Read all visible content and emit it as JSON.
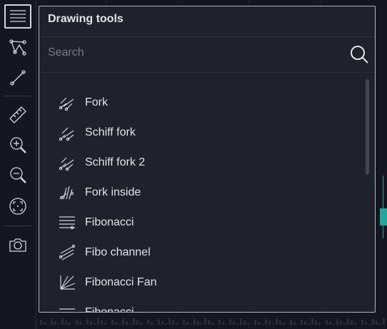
{
  "panel": {
    "title": "Drawing tools",
    "search_placeholder": "Search",
    "items": [
      {
        "label": "Fork",
        "icon": "pitchfork-icon"
      },
      {
        "label": "Schiff fork",
        "icon": "schiff-pitchfork-icon"
      },
      {
        "label": "Schiff fork 2",
        "icon": "schiff-pitchfork-2-icon"
      },
      {
        "label": "Fork inside",
        "icon": "inside-pitchfork-icon"
      },
      {
        "label": "Fibonacci",
        "icon": "fibonacci-retracement-icon"
      },
      {
        "label": "Fibo channel",
        "icon": "fibonacci-channel-icon"
      },
      {
        "label": "Fibonacci Fan",
        "icon": "fibonacci-fan-icon"
      },
      {
        "label": "Fibonacci ...",
        "icon": "fibonacci-more-icon"
      }
    ]
  },
  "toolbar": {
    "buttons": [
      {
        "name": "drawing-tools",
        "icon": "menu-lines-icon",
        "active": true
      },
      {
        "name": "patterns",
        "icon": "pattern-nodes-icon"
      },
      {
        "name": "trend-line",
        "icon": "trend-line-icon"
      },
      {
        "name": "ruler",
        "icon": "ruler-icon"
      },
      {
        "name": "zoom-in",
        "icon": "zoom-in-icon"
      },
      {
        "name": "zoom-out",
        "icon": "zoom-out-icon"
      },
      {
        "name": "fit-screen",
        "icon": "fit-screen-icon"
      },
      {
        "name": "screenshot",
        "icon": "camera-icon"
      }
    ]
  },
  "colors": {
    "background": "#131722",
    "panel": "#1e222d",
    "text": "#e1e3e8",
    "muted": "#787b86",
    "accent_green": "#26a69a"
  }
}
